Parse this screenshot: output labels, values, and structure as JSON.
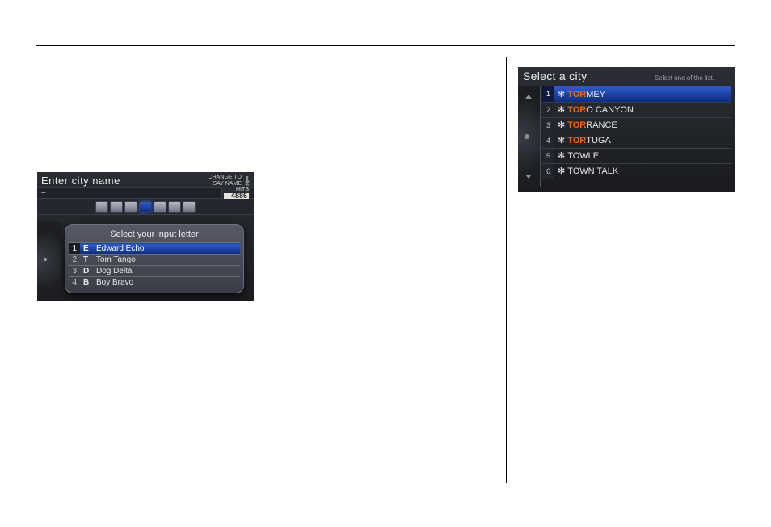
{
  "left_panel": {
    "title": "Enter city name",
    "change_to": "CHANGE TO",
    "say_name": "SAY NAME",
    "input_marker": "–",
    "hits_label": "HITS",
    "hits_value": "4886",
    "popup_title": "Select your input letter",
    "rows": [
      {
        "n": "1",
        "letter": "E",
        "name": "Edward Echo"
      },
      {
        "n": "2",
        "letter": "T",
        "name": "Tom Tango"
      },
      {
        "n": "3",
        "letter": "D",
        "name": "Dog Delta"
      },
      {
        "n": "4",
        "letter": "B",
        "name": "Boy Bravo"
      }
    ]
  },
  "right_panel": {
    "title": "Select a city",
    "subtitle": "Select one of the list.",
    "highlight_prefix": "TOR",
    "rows": [
      {
        "n": "1",
        "star": "✻",
        "pref": "TOR",
        "rest": "MEY"
      },
      {
        "n": "2",
        "star": "✻",
        "pref": "TOR",
        "rest": "O CANYON"
      },
      {
        "n": "3",
        "star": "✻",
        "pref": "TOR",
        "rest": "RANCE"
      },
      {
        "n": "4",
        "star": "✻",
        "pref": "TOR",
        "rest": "TUGA"
      },
      {
        "n": "5",
        "star": "✻",
        "pref": "",
        "rest": "TOWLE"
      },
      {
        "n": "6",
        "star": "✻",
        "pref": "",
        "rest": "TOWN TALK"
      }
    ]
  }
}
